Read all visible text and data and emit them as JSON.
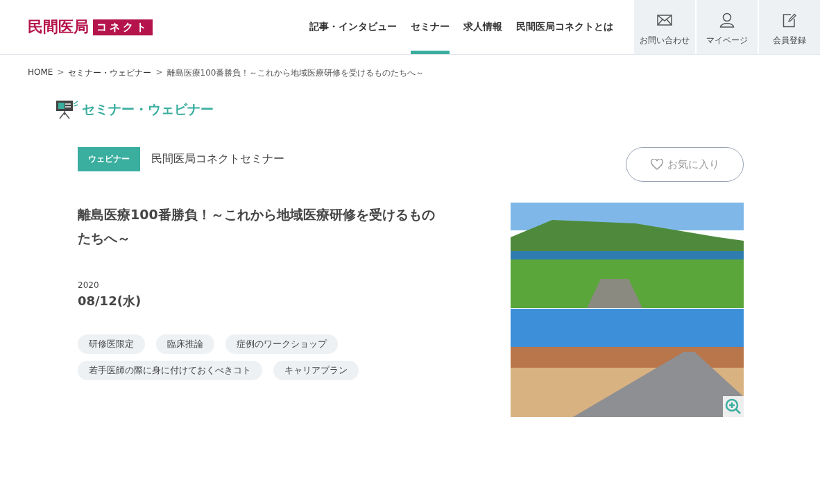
{
  "logo": {
    "main": "民間医局",
    "sub": "コネクト"
  },
  "nav": [
    {
      "label": "記事・インタビュー",
      "selected": false
    },
    {
      "label": "セミナー",
      "selected": true
    },
    {
      "label": "求人情報",
      "selected": false
    },
    {
      "label": "民間医局コネクトとは",
      "selected": false
    }
  ],
  "header_buttons": [
    {
      "kind": "mail",
      "label": "お問い合わせ"
    },
    {
      "kind": "person",
      "label": "マイページ"
    },
    {
      "kind": "register",
      "label": "会員登録"
    }
  ],
  "breadcrumb": [
    {
      "kind": "link",
      "text": "HOME"
    },
    {
      "kind": "separator",
      "text": ">"
    },
    {
      "kind": "link",
      "text": "セミナー・ウェビナー"
    },
    {
      "kind": "separator",
      "text": ">"
    },
    {
      "kind": "current",
      "text": "離島医療100番勝負！～これから地域医療研修を受けるものたちへ～"
    }
  ],
  "section_title": "セミナー・ウェビナー",
  "article": {
    "badge": "ウェビナー",
    "category": "民間医局コネクトセミナー",
    "favorite_button": "お気に入り",
    "title": "離島医療100番勝負！～これから地域医療研修を受けるものたちへ～",
    "year": "2020",
    "date": "08/12(水)",
    "tags": [
      "研修医限定",
      "臨床推論",
      "症例のワークショップ",
      "若手医師の際に身に付けておくべきコト",
      "キャリアプラン"
    ]
  }
}
